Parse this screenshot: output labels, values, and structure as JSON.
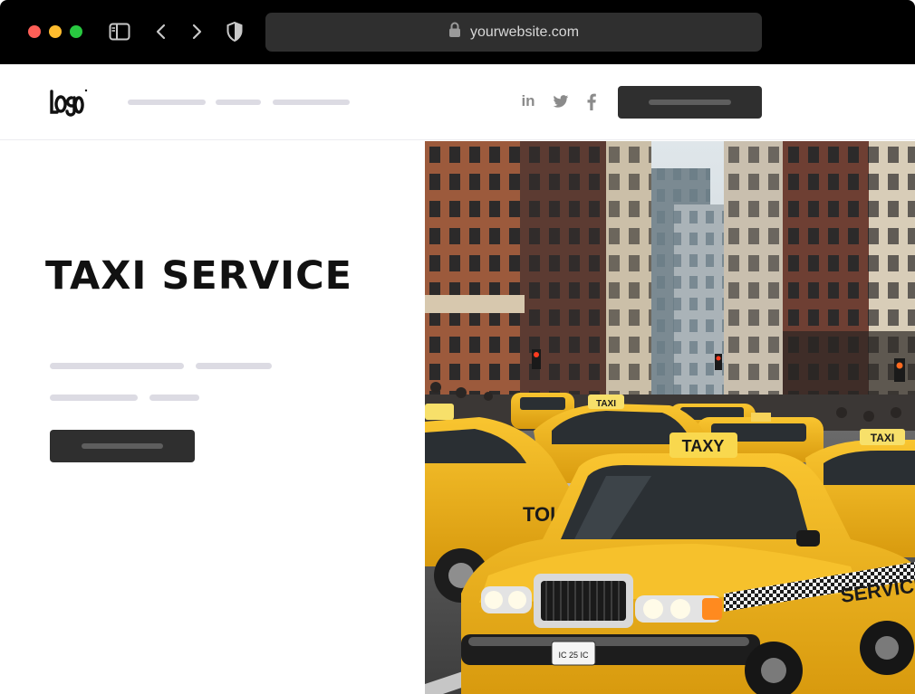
{
  "browser": {
    "url": "yourwebsite.com",
    "icons": [
      "sidebar-icon",
      "back-arrow-icon",
      "forward-arrow-icon",
      "shield-icon",
      "lock-icon"
    ]
  },
  "header": {
    "logo_text": "LOGO",
    "nav_items": [
      "",
      "",
      ""
    ],
    "social_icons": [
      "linkedin-icon",
      "twitter-icon",
      "facebook-icon"
    ],
    "linkedin_glyph": "in",
    "cta_label": ""
  },
  "hero": {
    "title": "TAXI SERVICE",
    "button_label": "",
    "image": {
      "subject": "city street with yellow taxi cabs",
      "car_sign_text": "TAXY",
      "car_door_text": "SERVICE",
      "plate_text": "IC 25 IC"
    }
  },
  "colors": {
    "chrome_bg": "#000000",
    "addressbar_bg": "#2f2f2f",
    "button_bg": "#2f2f2f",
    "placeholder_line": "#dcdbe3",
    "taxi_yellow": "#f2b319",
    "title_text": "#111111"
  }
}
